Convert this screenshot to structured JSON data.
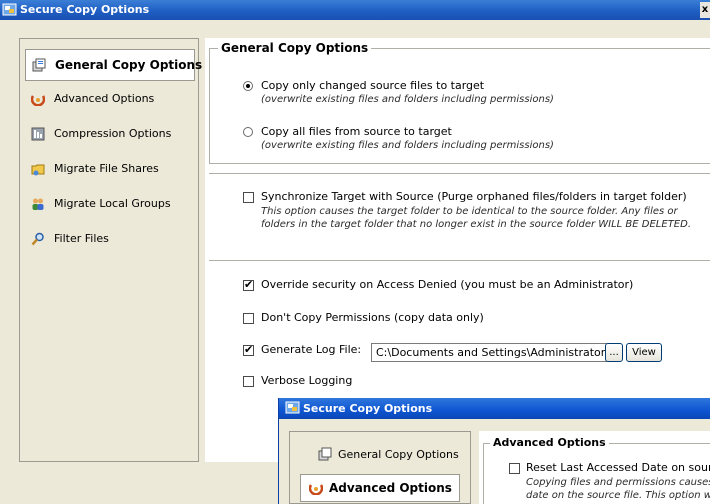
{
  "window": {
    "title": "Secure Copy Options",
    "close_glyph": "x"
  },
  "nav": {
    "items": [
      {
        "label": "General Copy Options",
        "icon": "general-copy-icon",
        "selected": true
      },
      {
        "label": "Advanced Options",
        "icon": "advanced-options-icon",
        "selected": false
      },
      {
        "label": "Compression Options",
        "icon": "compression-icon",
        "selected": false
      },
      {
        "label": "Migrate File Shares",
        "icon": "file-shares-icon",
        "selected": false
      },
      {
        "label": "Migrate Local Groups",
        "icon": "local-groups-icon",
        "selected": false
      },
      {
        "label": "Filter Files",
        "icon": "filter-files-icon",
        "selected": false
      }
    ]
  },
  "general": {
    "group_title": "General Copy Options",
    "copy_changed_label": "Copy only changed source files to target",
    "copy_changed_note": "(overwrite existing files and folders including permissions)",
    "copy_changed_checked": true,
    "copy_all_label": "Copy all files from source to target",
    "copy_all_note": "(overwrite existing files and folders including permissions)",
    "copy_all_checked": false,
    "sync_label": "Synchronize Target with Source (Purge orphaned files/folders in target folder)",
    "sync_note_1": "This option causes the target folder to be identical to the source folder.  Any files or",
    "sync_note_2": "folders in the target folder that no longer exist in the source folder WILL BE DELETED.",
    "sync_checked": false,
    "override_label": "Override security on Access Denied (you must be an Administrator)",
    "override_checked": true,
    "dont_copy_label": "Don't Copy Permissions (copy data only)",
    "dont_copy_checked": false,
    "log_label": "Generate Log File:",
    "log_checked": true,
    "log_path": "C:\\Documents and Settings\\Administrator\\Des",
    "browse_label": "...",
    "view_label": "View",
    "verbose_label": "Verbose Logging",
    "verbose_checked": false
  },
  "overlay": {
    "title": "Secure Copy Options",
    "nav_items": [
      {
        "label": "General Copy Options",
        "icon": "general-copy-icon"
      },
      {
        "label": "Advanced Options",
        "icon": "advanced-options-icon"
      }
    ],
    "group_title": "Advanced Options",
    "reset_label": "Reset Last Accessed Date on source fil",
    "reset_checked": false,
    "reset_note_1": "Copying files and permissions causes th",
    "reset_note_2": "date on the source file.  This option will"
  },
  "colors": {
    "title_bar": "#1f5fc4",
    "window_bg": "#ece9d8",
    "panel_bg": "#ffffff"
  }
}
